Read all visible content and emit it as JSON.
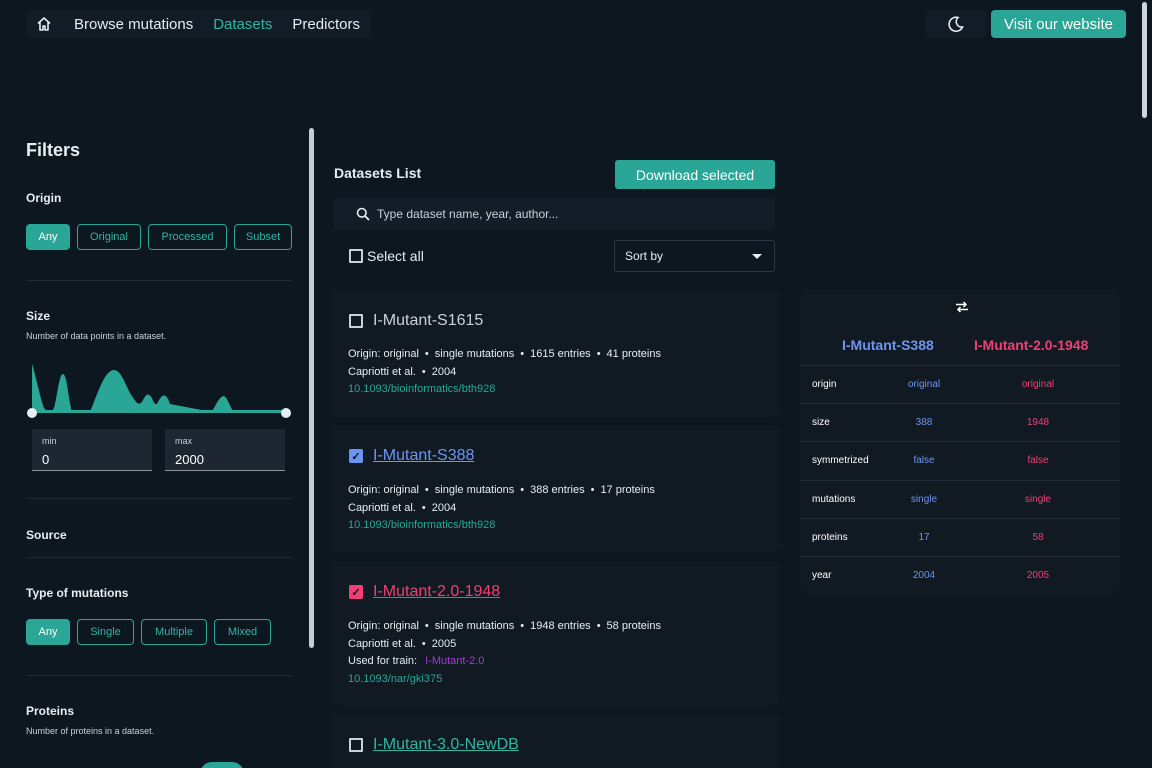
{
  "nav": {
    "items": [
      "Browse mutations",
      "Datasets",
      "Predictors"
    ],
    "active": "Datasets",
    "visit_label": "Visit our website"
  },
  "filters": {
    "title": "Filters",
    "origin": {
      "title": "Origin",
      "options": [
        "Any",
        "Original",
        "Processed",
        "Subset"
      ],
      "selected": "Any"
    },
    "size": {
      "title": "Size",
      "subtitle": "Number of data points in a dataset.",
      "min_label": "min",
      "min_value": "0",
      "max_label": "max",
      "max_value": "2000"
    },
    "source": {
      "title": "Source"
    },
    "type": {
      "title": "Type of mutations",
      "options": [
        "Any",
        "Single",
        "Multiple",
        "Mixed"
      ],
      "selected": "Any"
    },
    "proteins": {
      "title": "Proteins",
      "subtitle": "Number of proteins in a dataset."
    }
  },
  "list": {
    "title": "Datasets List",
    "download_label": "Download selected",
    "search_placeholder": "Type dataset name, year, author...",
    "select_all": "Select all",
    "sort_label": "Sort by",
    "cards": [
      {
        "name": "I-Mutant-S1615",
        "state": "unchecked",
        "line1": [
          "Origin: original",
          "single mutations",
          "1615 entries",
          "41 proteins"
        ],
        "line2": [
          "Capriotti et al.",
          "2004"
        ],
        "doi": "10.1093/bioinformatics/bth928"
      },
      {
        "name": "I-Mutant-S388",
        "state": "blue",
        "line1": [
          "Origin: original",
          "single mutations",
          "388 entries",
          "17 proteins"
        ],
        "line2": [
          "Capriotti et al.",
          "2004"
        ],
        "doi": "10.1093/bioinformatics/bth928"
      },
      {
        "name": "I-Mutant-2.0-1948",
        "state": "pink",
        "line1": [
          "Origin: original",
          "single mutations",
          "1948 entries",
          "58 proteins"
        ],
        "line2": [
          "Capriotti et al.",
          "2005"
        ],
        "train_label": "Used for train:",
        "train_value": "I-Mutant-2.0",
        "doi": "10.1093/nar/gki375"
      },
      {
        "name": "I-Mutant-3.0-NewDB",
        "state": "unchecked"
      }
    ]
  },
  "compare": {
    "left": "I-Mutant-S388",
    "right": "I-Mutant-2.0-1948",
    "rows": [
      {
        "key": "origin",
        "a": "original",
        "b": "original"
      },
      {
        "key": "size",
        "a": "388",
        "b": "1948"
      },
      {
        "key": "symmetrized",
        "a": "false",
        "b": "false"
      },
      {
        "key": "mutations",
        "a": "single",
        "b": "single"
      },
      {
        "key": "proteins",
        "a": "17",
        "b": "58"
      },
      {
        "key": "year",
        "a": "2004",
        "b": "2005"
      }
    ]
  },
  "colors": {
    "accent": "#2aa696",
    "blue": "#6b95f0",
    "pink": "#ef3f74",
    "purple": "#a23bd1"
  }
}
